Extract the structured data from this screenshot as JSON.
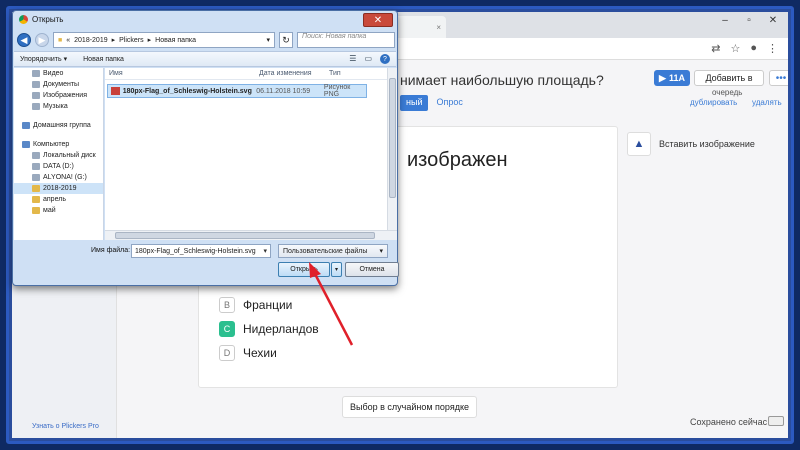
{
  "dialog": {
    "title": "Открыть",
    "breadcrumbs": [
      "«",
      "2018-2019",
      "Plickers",
      "Новая папка"
    ],
    "search_placeholder": "Поиск: Новая папка",
    "organize": "Упорядочить ▾",
    "new_folder": "Новая папка",
    "tree": [
      {
        "label": "Видео",
        "kind": "lib"
      },
      {
        "label": "Документы",
        "kind": "lib"
      },
      {
        "label": "Изображения",
        "kind": "lib"
      },
      {
        "label": "Музыка",
        "kind": "lib"
      },
      {
        "label": "Домашняя группа",
        "kind": "group"
      },
      {
        "label": "Компьютер",
        "kind": "pc"
      },
      {
        "label": "Локальный диск",
        "kind": "drive"
      },
      {
        "label": "DATA (D:)",
        "kind": "drive"
      },
      {
        "label": "ALYONA! (G:)",
        "kind": "drive"
      },
      {
        "label": "2018-2019",
        "kind": "folder"
      },
      {
        "label": "апрель",
        "kind": "folder"
      },
      {
        "label": "май",
        "kind": "folder"
      }
    ],
    "columns": {
      "name": "Имя",
      "date": "Дата изменения",
      "type": "Тип"
    },
    "file": {
      "name": "180px-Flag_of_Schleswig-Holstein.svg",
      "date": "06.11.2018 10:59",
      "type": "Рисунок PNG"
    },
    "filename_label": "Имя файла:",
    "filename_value": "180px-Flag_of_Schleswig-Holstein.svg",
    "filetype_value": "Пользовательские файлы",
    "open_label": "Открыть",
    "cancel_label": "Отмена"
  },
  "page": {
    "question_title": "нимает наибольшую площадь?",
    "btn_class": "11A",
    "btn_queue": "Добавить в",
    "queue_label": "очередь",
    "btn_more": "•••",
    "tab_active": "ный",
    "tab_poll": "Опрос",
    "duplicate": "дублировать",
    "delete": "удалять",
    "card_title": "изображен",
    "answers": [
      {
        "letter": "B",
        "text": "Франции",
        "correct": false
      },
      {
        "letter": "C",
        "text": "Нидерландов",
        "correct": true
      },
      {
        "letter": "D",
        "text": "Чехии",
        "correct": false
      }
    ],
    "insert_image": "Вставить изображение",
    "shuffle": "Выбор в случайном порядке",
    "saved": "Сохранено сейчас",
    "pro_link": "Узнать о Plickers Pro"
  },
  "colors": {
    "accent": "#3a7bd5",
    "correct": "#2bbf8f",
    "arrow": "#e0202a"
  }
}
